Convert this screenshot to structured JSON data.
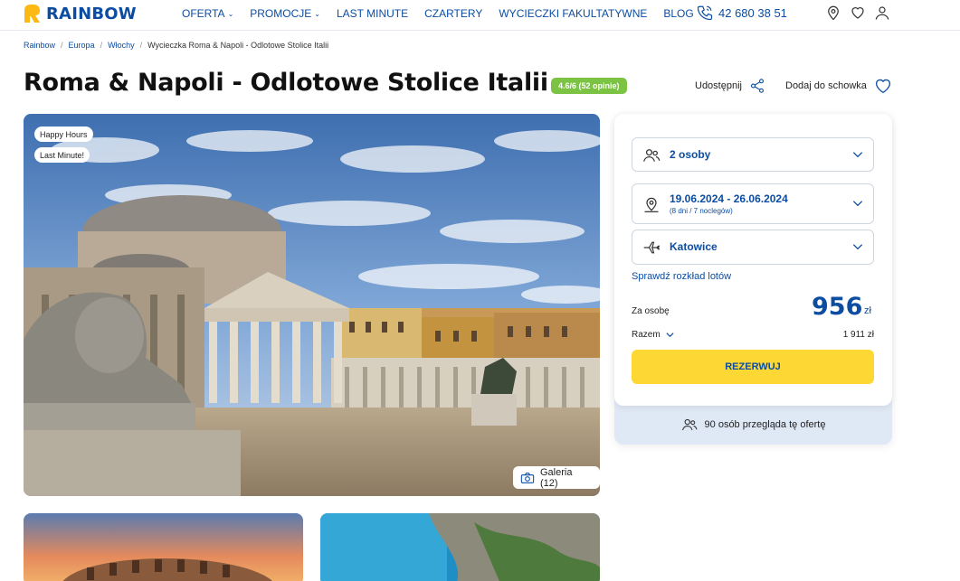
{
  "brand": {
    "name": "RAINBOW",
    "color": "#0c4da2",
    "accent": "#fdb913"
  },
  "nav": [
    {
      "label": "OFERTA",
      "dropdown": true
    },
    {
      "label": "PROMOCJE",
      "dropdown": true
    },
    {
      "label": "LAST MINUTE",
      "dropdown": false
    },
    {
      "label": "CZARTERY",
      "dropdown": false
    },
    {
      "label": "WYCIECZKI FAKULTATYWNE",
      "dropdown": false
    },
    {
      "label": "BLOG",
      "dropdown": false
    }
  ],
  "header": {
    "phone": "42 680 38 51",
    "icons": [
      "location-pin-icon",
      "heart-icon",
      "user-icon"
    ]
  },
  "breadcrumb": [
    "Rainbow",
    "Europa",
    "Włochy",
    "Wycieczka Roma & Napoli - Odlotowe Stolice Italii"
  ],
  "offer": {
    "title": "Roma & Napoli - Odlotowe Stolice Italii",
    "rating": "4.6/6 (52 opinie)",
    "share_label": "Udostępnij",
    "favorite_label": "Dodaj do schowka",
    "badges": [
      "Happy Hours",
      "Last Minute!"
    ],
    "gallery_label": "Galeria (12)"
  },
  "booking": {
    "persons": "2 osoby",
    "dates": "19.06.2024 - 26.06.2024",
    "dates_sub": "(8 dni / 7 noclegów)",
    "departure": "Katowice",
    "schedule_link": "Sprawdź rozkład lotów",
    "per_person_label": "Za osobę",
    "price": "956",
    "currency": "zł",
    "total_label": "Razem",
    "total_value": "1 911 zł",
    "book_label": "REZERWUJ",
    "viewers_text": "90 osób przegląda tę ofertę"
  }
}
